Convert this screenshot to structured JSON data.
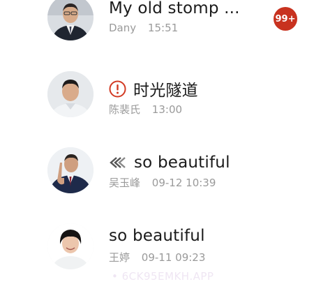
{
  "conversations": [
    {
      "title": "My old stomp ...",
      "sender": "Dany",
      "time": "15:51",
      "badge": "99+",
      "avatar_icon": "man-in-suit-avatar"
    },
    {
      "title": "时光隧道",
      "sender": "陈裴氏",
      "time": "13:00",
      "status_icon": "alert-circle-icon",
      "status_color": "#d23a23",
      "avatar_icon": "man-in-shirt-avatar"
    },
    {
      "title": "so beautiful",
      "sender": "吴玉峰",
      "time": "09-12 10:39",
      "status_icon": "double-chevron-left-icon",
      "avatar_icon": "businessman-pointing-avatar"
    },
    {
      "title": "so beautiful",
      "sender": "王婷",
      "time": "09-11 09:23",
      "avatar_icon": "young-man-avatar"
    }
  ],
  "watermark": "• 6CK95EMKH.APP",
  "colors": {
    "badge": "#c8321f",
    "title": "#1b1b1b",
    "meta": "#9a9a9a"
  }
}
